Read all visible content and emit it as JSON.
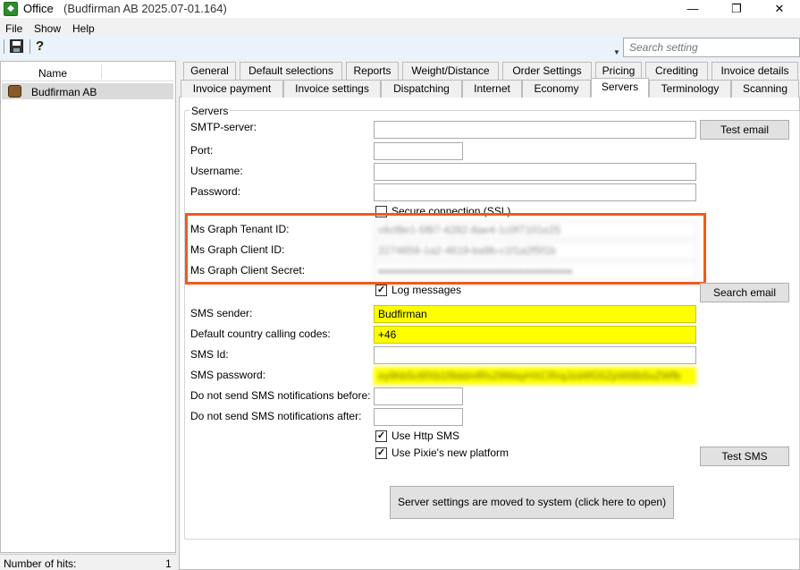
{
  "window": {
    "title": "Office",
    "subtitle": "(Budfirman AB 2025.07-01.164)",
    "controls": {
      "minimize": "—",
      "restore": "❐",
      "close": "✕"
    }
  },
  "menu": {
    "items": [
      "File",
      "Show",
      "Help"
    ]
  },
  "toolbar": {
    "search_placeholder": "Search setting",
    "icons": [
      "save-icon",
      "help-icon"
    ]
  },
  "left_panel": {
    "column_header": "Name",
    "items": [
      {
        "label": "Budfirman AB"
      }
    ],
    "status_label": "Number of hits:",
    "status_count": "1"
  },
  "tabs": {
    "row1": [
      "General",
      "Default selections",
      "Reports",
      "Weight/Distance",
      "Order Settings",
      "Pricing",
      "Crediting",
      "Invoice details"
    ],
    "row2": [
      "Invoice payment",
      "Invoice settings",
      "Dispatching",
      "Internet",
      "Economy",
      "Servers",
      "Terminology",
      "Scanning"
    ],
    "active": "Servers"
  },
  "servers": {
    "group_label": "Servers",
    "labels": {
      "smtp_server": "SMTP-server:",
      "port": "Port:",
      "username": "Username:",
      "password": "Password:",
      "tenant_id": "Ms Graph Tenant ID:",
      "client_id": "Ms Graph Client ID:",
      "client_secret": "Ms Graph Client Secret:",
      "sms_sender": "SMS sender:",
      "country_codes": "Default country calling codes:",
      "sms_id": "SMS Id:",
      "sms_password": "SMS password:",
      "no_sms_before": "Do not send SMS notifications before:",
      "no_sms_after": "Do not send SMS notifications after:"
    },
    "values": {
      "smtp_server": "",
      "port": "",
      "username": "",
      "password": "",
      "tenant_id": "c6cf8e1-5f87-4282-8ae4-1c0f7101e25",
      "client_id": "2274659-1a2-4619-ba9b-c1f1a2f5f1b",
      "client_secret": "●●●●●●●●●●●●●●●●●●●●●●●●●●●●●●●●●●●●●●●●",
      "sms_sender": "Budfirman",
      "country_codes": "+46",
      "sms_id": "",
      "sms_password": "ey9hb5c6fXb1f9ddmfRs29WayHXCRrqJzd4fG5ZpWt8b5uZWfb",
      "no_sms_before": "",
      "no_sms_after": ""
    },
    "checkboxes": {
      "ssl": {
        "label": "Secure connection (SSL)",
        "checked": false
      },
      "log_messages": {
        "label": "Log messages",
        "checked": true
      },
      "use_http_sms": {
        "label": "Use Http SMS",
        "checked": true
      },
      "pixie_platform": {
        "label": "Use Pixie's new platform",
        "checked": true
      }
    },
    "buttons": {
      "test_email": "Test email",
      "search_email": "Search email",
      "test_sms": "Test SMS",
      "moved": "Server settings are moved to system (click here to open)"
    }
  },
  "colors": {
    "highlight_border": "#f05a1e",
    "yellow_field": "#ffff00",
    "toolbar_bg": "#eaf3fc"
  }
}
